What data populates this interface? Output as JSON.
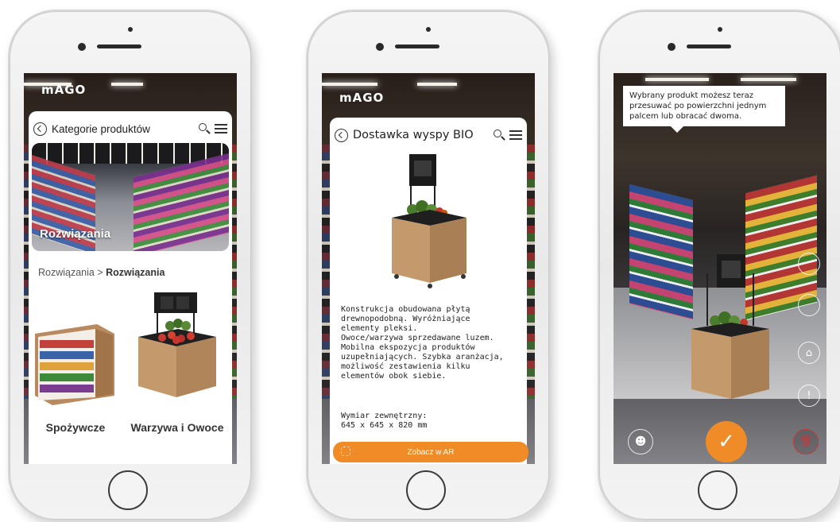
{
  "brand": {
    "logo_text": "mAGO",
    "accent_color": "#f08c28"
  },
  "screen1": {
    "header_title": "Kategorie produktów",
    "hero_label": "Rozwiązania",
    "breadcrumb": {
      "parent": "Rozwiązania",
      "separator": " > ",
      "current": "Rozwiązania"
    },
    "products": [
      {
        "name": "Spożywcze"
      },
      {
        "name": "Warzywa i Owoce"
      }
    ]
  },
  "screen2": {
    "header_title": "Dostawka wyspy BIO",
    "description": "Konstrukcja obudowana płytą\ndrewnopodobną. Wyróżniające\nelementy pleksi.\nOwoce/warzywa sprzedawane luzem.\nMobilna ekspozycja produktów\nuzupełniających. Szybka aranżacja,\nmożliwość zestawienia kilku\nelementów obok siebie.",
    "dimension_label": "Wymiar zewnętrzny:",
    "dimension_value": "645 x 645 x 820 mm",
    "ar_button_label": "Zobacz w AR"
  },
  "screen3": {
    "tooltip": "Wybrany produkt możesz teraz przesuwać po powierzchni jednym palcem lub obracać dwoma."
  }
}
